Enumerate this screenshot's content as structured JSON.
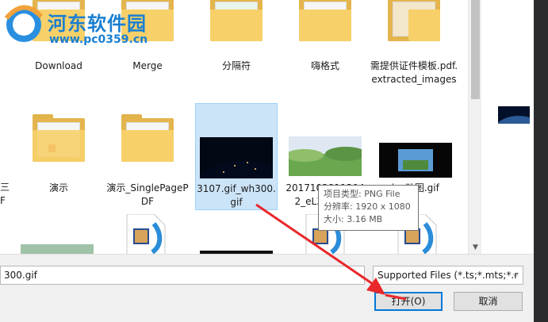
{
  "watermark": {
    "title": "河东软件园",
    "url": "www.pc0359.cn"
  },
  "files": [
    {
      "label": "Download",
      "kind": "folder"
    },
    {
      "label": "Merge",
      "kind": "folder"
    },
    {
      "label": "分隔符",
      "kind": "folder"
    },
    {
      "label": "嗨格式",
      "kind": "folder"
    },
    {
      "label": "需提供证件模板.pdf.extracted_images",
      "kind": "folder"
    },
    {
      "label": "演示",
      "kind": "folder"
    },
    {
      "label": "演示_SinglePagePDF",
      "kind": "folder"
    },
    {
      "label": "3107.gif_wh300.gif",
      "kind": "image",
      "selected": true
    },
    {
      "label": "20171028113042_eL3Vu.png",
      "kind": "image"
    },
    {
      "label": "min_动图.gif",
      "kind": "image"
    }
  ],
  "partial_labels": [
    "Download",
    "Merge",
    "分隔符",
    "嗨格式",
    "需提供证件模板.pdf.extracted_images"
  ],
  "left_cut": [
    "三",
    "F"
  ],
  "tooltip": {
    "type_line": "项目类型: PNG File",
    "dim_line": "分辨率: 1920 x 1080",
    "size_line": "大小: 3.16 MB"
  },
  "filename": {
    "value": "300.gif"
  },
  "filetype": {
    "selected": "Supported Files (*.ts;*.mts;*.r"
  },
  "buttons": {
    "open": "打开(O)",
    "cancel": "取消"
  },
  "colors": {
    "accent": "#0078d7",
    "selection": "#cce4f7",
    "folder": "#f7d06a",
    "arrow": "#e8272b",
    "watermark": "#1a7fd1"
  }
}
